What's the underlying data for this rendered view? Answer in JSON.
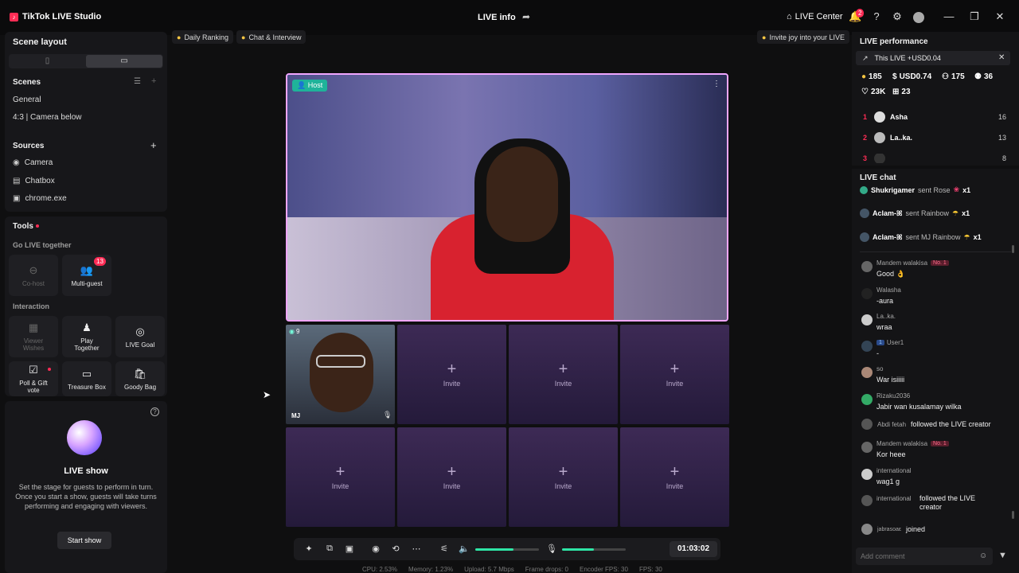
{
  "app": {
    "title": "TikTok LIVE Studio",
    "live_info": "LIVE info",
    "live_center": "LIVE Center",
    "notif_count": "2"
  },
  "left": {
    "scene_layout": "Scene layout",
    "scenes_title": "Scenes",
    "scenes": [
      "General",
      "4:3 | Camera below"
    ],
    "sources_title": "Sources",
    "sources": [
      "Camera",
      "Chatbox",
      "chrome.exe"
    ],
    "tools_title": "Tools",
    "go_live_together": "Go LIVE together",
    "cohost": "Co-host",
    "multiguest": "Multi-guest",
    "multiguest_badge": "13",
    "interaction": "Interaction",
    "viewer_wishes_1": "Viewer",
    "viewer_wishes_2": "Wishes",
    "play_together_1": "Play",
    "play_together_2": "Together",
    "live_goal": "LIVE Goal",
    "poll_1": "Poll & Gift",
    "poll_2": "vote",
    "treasure_box": "Treasure Box",
    "goody_bag": "Goody Bag",
    "live_show_title": "LIVE show",
    "live_show_desc": "Set the stage for guests to perform in turn. Once you start a show, guests will take turns performing and engaging with viewers.",
    "start_show": "Start show"
  },
  "center": {
    "daily_ranking": "Daily Ranking",
    "chat_interview": "Chat & Interview",
    "invite_joy": "Invite joy into your LIVE",
    "host_tag": "Host",
    "guest_name": "MJ",
    "guest_count": "9",
    "invite": "Invite",
    "timer": "01:03:02",
    "volume_level": 0.6,
    "mic_level": 0.5,
    "stats": [
      "CPU: 2.53%",
      "Memory: 1.23%",
      "Upload: 5.7 Mbps",
      "Frame drops: 0",
      "Encoder FPS: 30",
      "FPS: 30"
    ]
  },
  "right": {
    "perf_title": "LIVE performance",
    "this_live": "This LIVE +USD0.04",
    "viewers": "185",
    "usd": "USD0.74",
    "followers": "175",
    "new_followers": "36",
    "likes": "23K",
    "gifts": "23",
    "ranking": [
      {
        "rank": "1",
        "name": "Asha",
        "score": "16"
      },
      {
        "rank": "2",
        "name": "La..ka.",
        "score": "13"
      },
      {
        "rank": "3",
        "name": "",
        "score": "8"
      }
    ],
    "chat_title": "LIVE chat",
    "gift_msgs": [
      {
        "name": "Shukrigamer",
        "text": "sent Rose",
        "count": "x1"
      },
      {
        "name": "Aclam-ꕤ",
        "text": "sent Rainbow",
        "count": "x1"
      },
      {
        "name": "Aclam-ꕤ",
        "text": "sent MJ Rainbow",
        "count": "x1"
      }
    ],
    "chat": [
      {
        "name": "Mandem walakisa",
        "badge": "No. 1",
        "msg": "Good 👌"
      },
      {
        "name": "Walasha",
        "badge": "",
        "msg": "-aura"
      },
      {
        "name": "La..ka.",
        "badge": "",
        "msg": "wraa"
      },
      {
        "name": "User1",
        "badge": "1",
        "msg": "-"
      },
      {
        "name": "so",
        "badge": "",
        "msg": "War isiiiii"
      },
      {
        "name": "Rizaku2036",
        "badge": "",
        "msg": "Jabir wan kusalamay wilka"
      },
      {
        "name": "Mandem walakisa",
        "badge": "No. 1",
        "msg": "Kor heee"
      },
      {
        "name": "international",
        "badge": "",
        "msg": "wag1 g"
      }
    ],
    "follow1_name": "Abdi fetah",
    "follow1_text": "followed the LIVE creator",
    "follow2_name": "international",
    "follow2_text": "followed the LIVE creator",
    "join_name": "jabrasoaε",
    "join_text": "joined",
    "add_comment": "Add comment"
  },
  "colors": {
    "accent": "#fe2c55",
    "teal": "#1fb39a",
    "slider": "#2ee6a6"
  }
}
